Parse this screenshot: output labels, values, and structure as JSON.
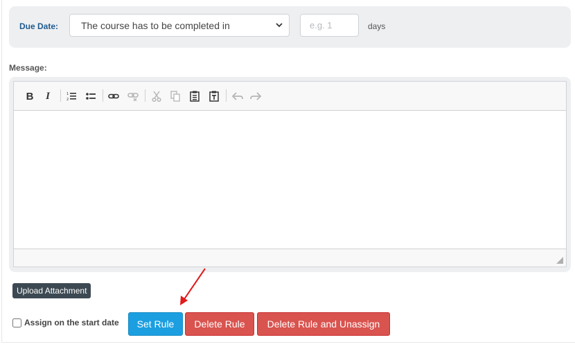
{
  "due_date": {
    "label": "Due Date:",
    "select_value": "The course has to be completed in",
    "days_placeholder": "e.g. 1",
    "days_unit": "days"
  },
  "message": {
    "label": "Message:",
    "toolbar": [
      {
        "icon": "bold-icon",
        "glyph": "B",
        "enabled": true
      },
      {
        "icon": "italic-icon",
        "glyph": "I",
        "enabled": true
      },
      {
        "icon": "numbered-list-icon",
        "enabled": true
      },
      {
        "icon": "bulleted-list-icon",
        "enabled": true
      },
      {
        "icon": "link-icon",
        "enabled": true
      },
      {
        "icon": "unlink-icon",
        "enabled": false
      },
      {
        "icon": "cut-icon",
        "enabled": false
      },
      {
        "icon": "copy-icon",
        "enabled": false
      },
      {
        "icon": "paste-icon",
        "enabled": true
      },
      {
        "icon": "paste-text-icon",
        "enabled": true
      },
      {
        "icon": "undo-icon",
        "enabled": false
      },
      {
        "icon": "redo-icon",
        "enabled": false
      }
    ],
    "body": ""
  },
  "upload_button": "Upload Attachment",
  "assign_checkbox": {
    "label": "Assign on the start date",
    "checked": false
  },
  "actions": {
    "set_rule": "Set Rule",
    "delete_rule": "Delete Rule",
    "delete_unassign": "Delete Rule and Unassign"
  },
  "colors": {
    "primary": "#1c9fe0",
    "danger": "#d9534f",
    "dark": "#3c4952",
    "label_blue": "#1f5a8e",
    "annotation_arrow": "#e01b1b"
  }
}
